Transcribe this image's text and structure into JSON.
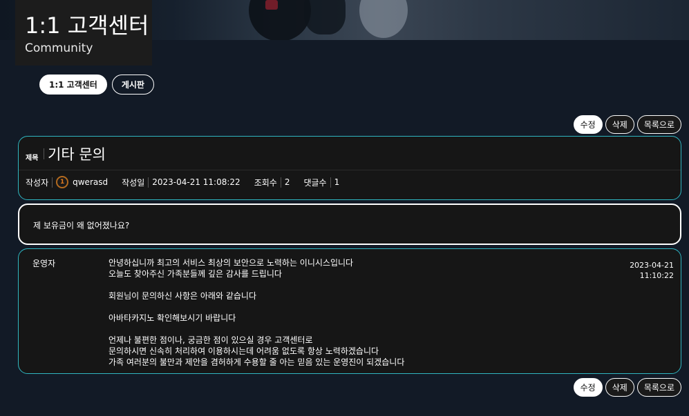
{
  "page": {
    "title": "1:1 고객센터",
    "subtitle": "Community"
  },
  "tabs": [
    {
      "label": "1:1 고객센터",
      "active": true
    },
    {
      "label": "게시판",
      "active": false
    }
  ],
  "actions": {
    "edit": "수정",
    "delete": "삭제",
    "list": "목록으로"
  },
  "post": {
    "title_label": "제목",
    "title": "기타 문의",
    "author_label": "작성자",
    "author": "qwerasd",
    "author_badge": "1",
    "date_label": "작성일",
    "date": "2023-04-21 11:08:22",
    "views_label": "조회수",
    "views": "2",
    "comments_label": "댓글수",
    "comments": "1",
    "body": "제 보유금이 왜 없어졌나요?"
  },
  "answer": {
    "author": "운영자",
    "lines": [
      "안녕하십니까 최고의 서비스 최상의 보안으로 노력하는 이니시스입니다",
      "오늘도 찾아주신 가족분들께 깊은 감사를 드립니다",
      "",
      "회원님이 문의하신 사항은 아래와 같습니다",
      "",
      "아바타카지노 확인해보시기 바랍니다",
      "",
      "언제나 불편한 점이나, 궁금한 점이 있으실 경우 고객센터로",
      "문의하시면 신속히 처리하여 이용하시는데 어려움 없도록 항상 노력하겠습니다",
      "가족 여러분의 불만과 제안을 겸허하게 수용할 줄 아는 믿음 있는 운영진이 되겠습니다"
    ],
    "date": "2023-04-21",
    "time": "11:10:22"
  },
  "colors": {
    "background": "#121a26",
    "card": "#161616",
    "accent": "#2fb7c2",
    "avatar": "#b36a1f"
  }
}
